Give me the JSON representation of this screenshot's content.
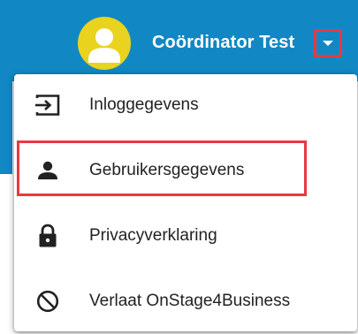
{
  "header": {
    "user_name": "Coördinator Test",
    "avatar_icon": "user-avatar-icon",
    "dropdown_icon": "caret-down-icon",
    "background_color": "#1188c4",
    "avatar_color": "#e9d31e"
  },
  "menu": {
    "items": [
      {
        "label": "Inloggegevens",
        "icon": "login-icon"
      },
      {
        "label": "Gebruikersgegevens",
        "icon": "person-icon"
      },
      {
        "label": "Privacyverklaring",
        "icon": "lock-icon"
      },
      {
        "label": "Verlaat OnStage4Business",
        "icon": "block-icon"
      }
    ]
  },
  "annotations": {
    "highlight_color": "#e8393f"
  }
}
